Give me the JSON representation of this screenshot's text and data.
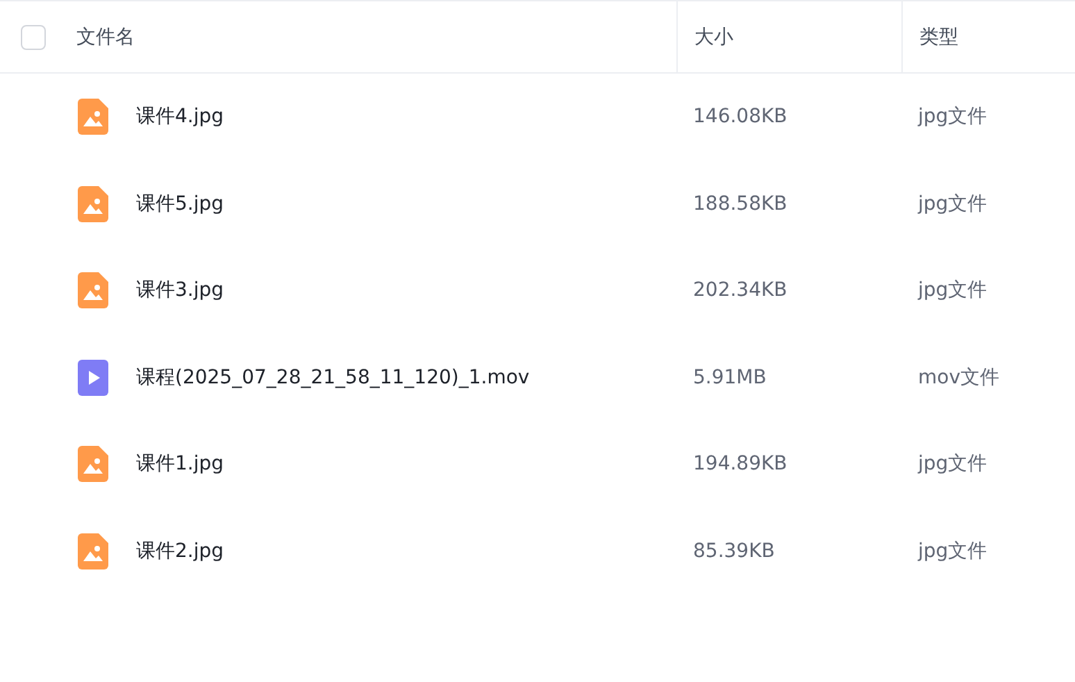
{
  "header": {
    "checked": false,
    "columns": [
      "文件名",
      "大小",
      "类型"
    ]
  },
  "rows": [
    {
      "kind": "image",
      "name": "课件4.jpg",
      "size": "146.08KB",
      "type": "jpg文件"
    },
    {
      "kind": "image",
      "name": "课件5.jpg",
      "size": "188.58KB",
      "type": "jpg文件"
    },
    {
      "kind": "image",
      "name": "课件3.jpg",
      "size": "202.34KB",
      "type": "jpg文件"
    },
    {
      "kind": "video",
      "name": "课程(2025_07_28_21_58_11_120)_1.mov",
      "size": "5.91MB",
      "type": "mov文件"
    },
    {
      "kind": "image",
      "name": "课件1.jpg",
      "size": "194.89KB",
      "type": "jpg文件"
    },
    {
      "kind": "image",
      "name": "课件2.jpg",
      "size": "85.39KB",
      "type": "jpg文件"
    }
  ]
}
